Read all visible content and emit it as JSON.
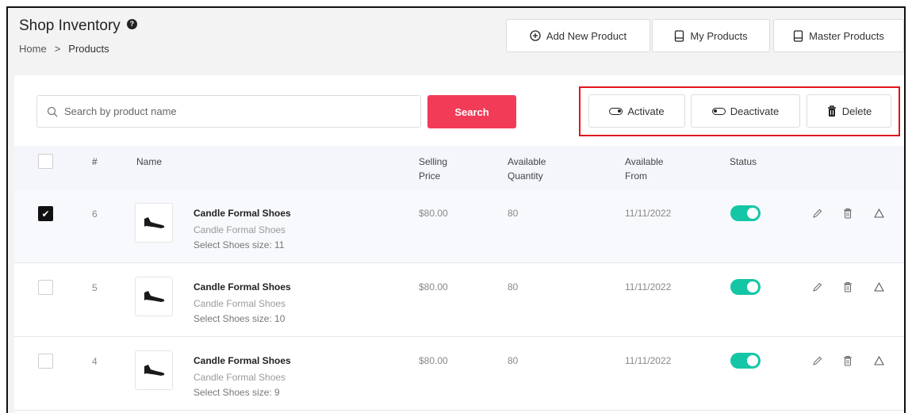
{
  "header": {
    "title": "Shop Inventory",
    "breadcrumb": [
      "Home",
      ">",
      "Products"
    ]
  },
  "top_buttons": {
    "add_new_product": "Add New Product",
    "my_products": "My Products",
    "master_products": "Master Products"
  },
  "search": {
    "placeholder": "Search by product name",
    "value": "",
    "button": "Search"
  },
  "bulk_actions": {
    "activate": "Activate",
    "deactivate": "Deactivate",
    "delete": "Delete"
  },
  "table": {
    "columns": {
      "index": "#",
      "name": "Name",
      "selling_price": [
        "Selling",
        "Price"
      ],
      "available_quantity": [
        "Available",
        "Quantity"
      ],
      "available_from": [
        "Available",
        "From"
      ],
      "status": "Status"
    },
    "rows": [
      {
        "checked": true,
        "index": "6",
        "name": "Candle Formal Shoes",
        "subtitle": "Candle Formal Shoes",
        "variant": "Select Shoes size: 11",
        "price": "$80.00",
        "quantity": "80",
        "available_from": "11/11/2022",
        "status_active": true
      },
      {
        "checked": false,
        "index": "5",
        "name": "Candle Formal Shoes",
        "subtitle": "Candle Formal Shoes",
        "variant": "Select Shoes size: 10",
        "price": "$80.00",
        "quantity": "80",
        "available_from": "11/11/2022",
        "status_active": true
      },
      {
        "checked": false,
        "index": "4",
        "name": "Candle Formal Shoes",
        "subtitle": "Candle Formal Shoes",
        "variant": "Select Shoes size: 9",
        "price": "$80.00",
        "quantity": "80",
        "available_from": "11/11/2022",
        "status_active": true
      }
    ]
  },
  "colors": {
    "search_button": "#f13b57",
    "status_active": "#14c6a6",
    "highlight": "#e0141c"
  },
  "icons": {
    "help": "help-circle-icon",
    "add": "plus-circle-icon",
    "products": "document-icon",
    "search": "search-icon",
    "activate": "toggle-on-icon",
    "deactivate": "toggle-off-icon",
    "delete": "trash-icon",
    "edit": "pencil-icon",
    "warning": "warning-icon"
  }
}
